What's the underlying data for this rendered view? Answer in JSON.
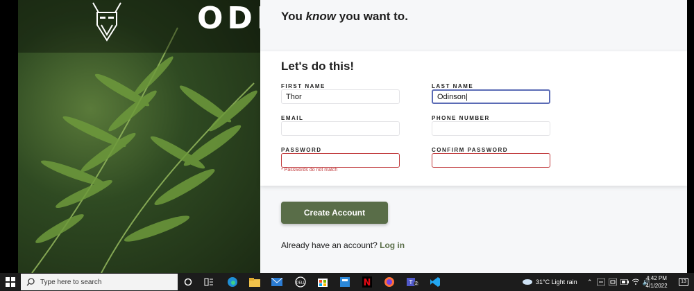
{
  "brand": {
    "logo_text": "ODIN"
  },
  "form": {
    "tagline_before": "You ",
    "tagline_em": "know",
    "tagline_after": " you want to.",
    "card_title": "Let's do this!",
    "fields": {
      "first_name": {
        "label": "FIRST NAME",
        "value": "Thor"
      },
      "last_name": {
        "label": "LAST NAME",
        "value": "Odinson|"
      },
      "email": {
        "label": "EMAIL",
        "value": ""
      },
      "phone": {
        "label": "PHONE NUMBER",
        "value": ""
      },
      "password": {
        "label": "PASSWORD",
        "value": ""
      },
      "confirm_password": {
        "label": "CONFIRM PASSWORD",
        "value": ""
      }
    },
    "error_message": "* Passwords do not match",
    "submit_label": "Create Account",
    "login_prompt": "Already have an account?",
    "login_link": "Log in",
    "accent_color": "#596d48",
    "error_color": "#c0393b"
  },
  "taskbar": {
    "search_placeholder": "Type here to search",
    "apps": [
      "cortana-icon",
      "task-view-icon",
      "edge-icon",
      "file-explorer-icon",
      "mail-icon",
      "dell-icon",
      "store-icon",
      "calculator-icon",
      "netflix-icon",
      "firefox-icon",
      "teams-icon",
      "vscode-icon"
    ],
    "teams_badge": "2",
    "weather": "31°C  Light rain",
    "time": "4:42 PM",
    "date": "4/1/2022",
    "notification_count": "13"
  }
}
